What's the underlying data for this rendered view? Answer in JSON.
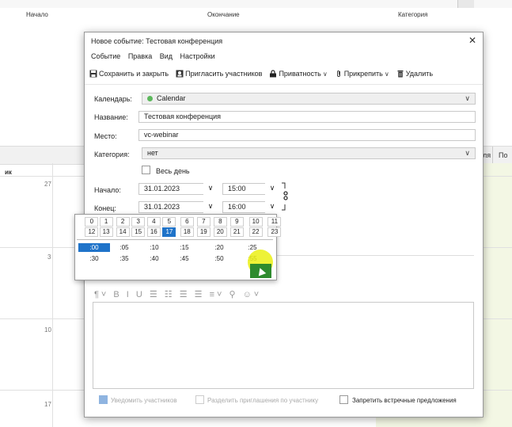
{
  "bg": {
    "columns": {
      "start": "Начало",
      "end": "Окончание",
      "category": "Категория"
    },
    "week_bar": {
      "col_a": "ля",
      "col_b": "По"
    },
    "day_label": "ик",
    "day_numbers": [
      "27",
      "3",
      "10",
      "17"
    ]
  },
  "dialog": {
    "title": "Новое событие: Тестовая конференция",
    "close": "✕",
    "menu": [
      "Событие",
      "Правка",
      "Вид",
      "Настройки"
    ],
    "toolbar": {
      "save_close": "Сохранить и закрыть",
      "invite": "Пригласить участников",
      "privacy": "Приватность",
      "attach": "Прикрепить",
      "delete": "Удалить"
    },
    "labels": {
      "calendar": "Календарь:",
      "title": "Название:",
      "location": "Место:",
      "category": "Категория:",
      "start": "Начало:",
      "end": "Конец:"
    },
    "calendar_value": "Calendar",
    "title_value": "Тестовая конференция",
    "location_value": "vc-webinar",
    "category_value": "нет",
    "allday_label": "Весь день",
    "start_date": "31.01.2023",
    "start_time": "15:00",
    "end_date": "31.01.2023",
    "end_time": "16:00",
    "bottom": {
      "notify": "Уведомить участников",
      "separate": "Разделить приглашения по участнику",
      "disallow": "Запретить встречные предложения"
    },
    "format_toolbar": "¶˅ B I U ☰ ☷ ☰ ☰ ≡˅ ⚲ ☺˅"
  },
  "picker": {
    "hours_row1": [
      "0",
      "1",
      "2",
      "3",
      "4",
      "5",
      "6",
      "7",
      "8",
      "9",
      "10",
      "11"
    ],
    "hours_row2": [
      "12",
      "13",
      "14",
      "15",
      "16",
      "17",
      "18",
      "19",
      "20",
      "21",
      "22",
      "23"
    ],
    "selected_hour": "17",
    "minutes_row1": [
      ":00",
      ":05",
      ":10",
      ":15",
      ":20",
      ":25"
    ],
    "minutes_row2": [
      ":30",
      ":35",
      ":40",
      ":45",
      ":50",
      ":55"
    ],
    "selected_minute": ":00"
  },
  "colors": {
    "accent": "#1f73c9",
    "calendar_dot": "#5cb85c"
  }
}
